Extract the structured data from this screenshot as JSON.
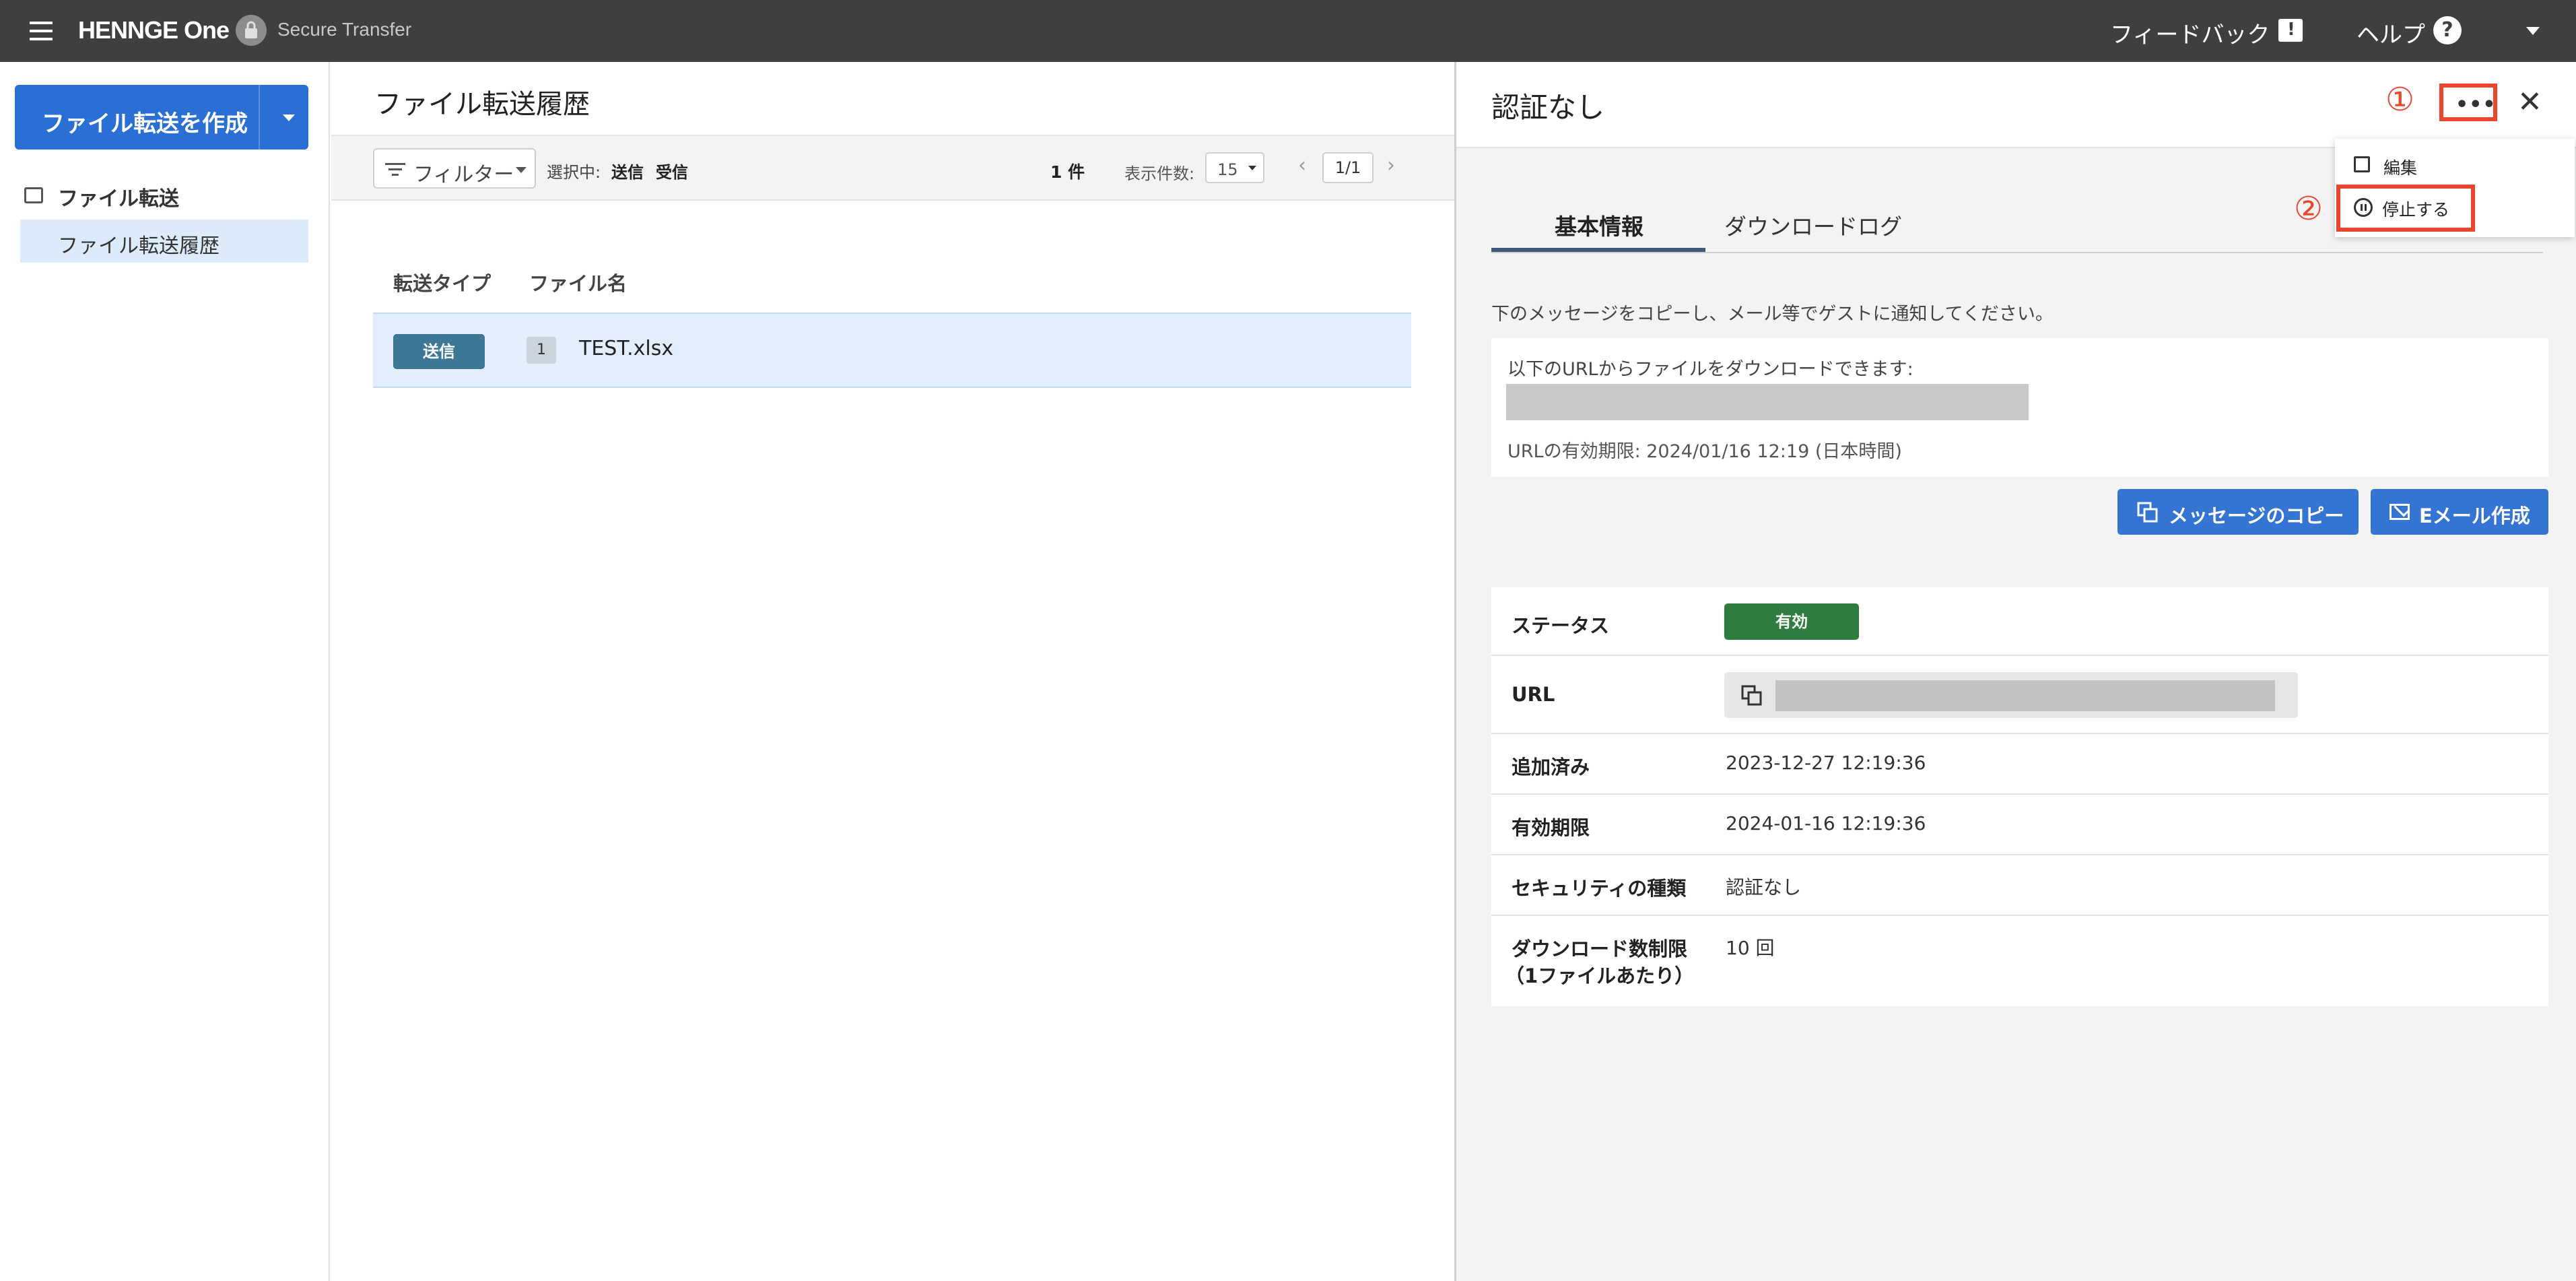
{
  "topbar": {
    "logo": "HENNGE One",
    "app_name": "Secure Transfer",
    "feedback": "フィードバック",
    "help": "ヘルプ",
    "help_icon": "?"
  },
  "sidebar": {
    "create_button": "ファイル転送を作成",
    "group_label": "ファイル転送",
    "items": [
      {
        "label": "ファイル転送履歴"
      }
    ]
  },
  "list": {
    "title": "ファイル転送履歴",
    "filter_label": "フィルター",
    "selected_label": "選択中:",
    "selected_values": [
      "送信",
      "受信"
    ],
    "count": "1 件",
    "per_page_label": "表示件数:",
    "per_page_value": "15",
    "page": "1/1",
    "columns": [
      "転送タイプ",
      "ファイル名"
    ],
    "rows": [
      {
        "type": "送信",
        "file_count": "1",
        "file_name": "TEST.xlsx"
      }
    ]
  },
  "detail": {
    "title": "認証なし",
    "marker_1": "①",
    "marker_2": "②",
    "more_label": "•••",
    "close_label": "✕",
    "tabs": [
      {
        "label": "基本情報",
        "active": true
      },
      {
        "label": "ダウンロードログ",
        "active": false
      }
    ],
    "guide": "下のメッセージをコピーし、メール等でゲストに通知してください。",
    "message_line1": "以下のURLからファイルをダウンロードできます:",
    "message_line3": "URLの有効期限: 2024/01/16 12:19 (日本時間)",
    "copy_message_button": "メッセージのコピー",
    "email_button": "Eメール作成",
    "info": {
      "status_label": "ステータス",
      "status_value": "有効",
      "url_label": "URL",
      "added_label": "追加済み",
      "added_value": "2023-12-27 12:19:36",
      "expiry_label": "有効期限",
      "expiry_value": "2024-01-16 12:19:36",
      "security_label": "セキュリティの種類",
      "security_value": "認証なし",
      "dl_limit_label_1": "ダウンロード数制限",
      "dl_limit_label_2": "（1ファイルあたり）",
      "dl_limit_value": "10 回"
    },
    "status_color": "#2e7d3e"
  },
  "menu": {
    "edit": "編集",
    "stop": "停止する"
  },
  "colors": {
    "primary": "#2a6fd3",
    "topbar": "#3f3f3f",
    "highlight": "#e8472b"
  }
}
